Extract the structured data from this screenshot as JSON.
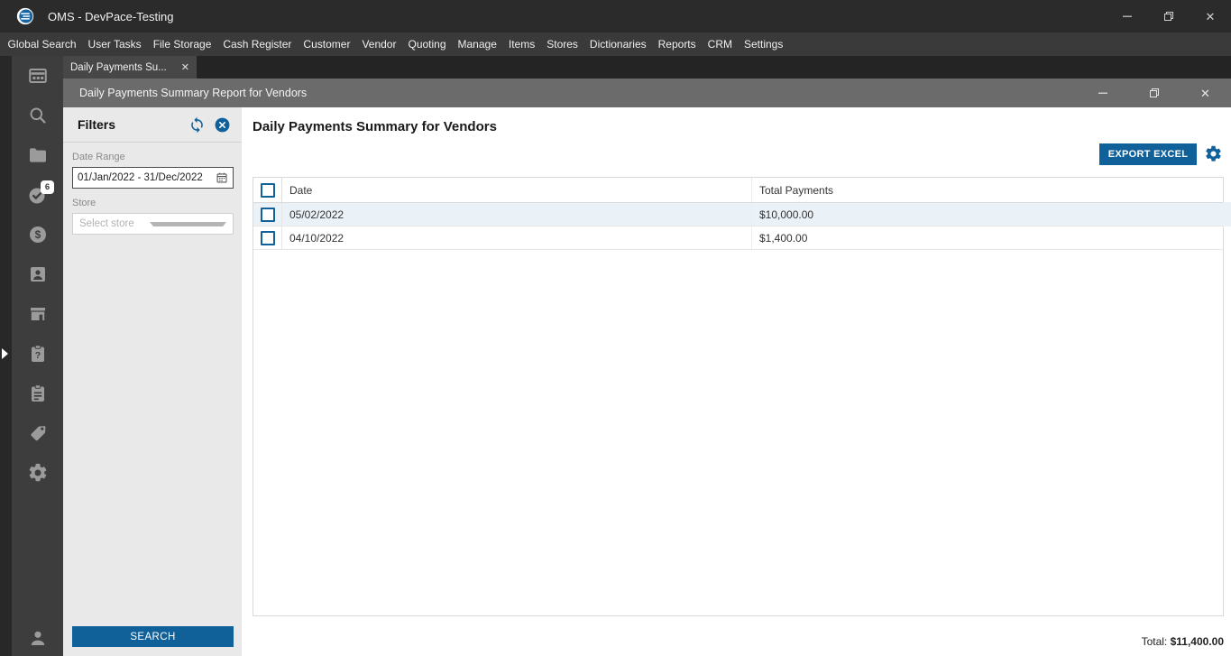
{
  "colors": {
    "accent": "#10609a",
    "row_highlight": "#eaf2f7",
    "titlebar_bg": "#2b2b2b",
    "menubar_bg": "#3a3a3a",
    "sidebar_bg": "#3d3d3d",
    "doc_titlebar_bg": "#6b6b6b",
    "filters_bg": "#e9e9e9"
  },
  "titlebar": {
    "title": "OMS - DevPace-Testing",
    "controls": {
      "minimize": "minimize",
      "restore": "restore",
      "close": "✕"
    }
  },
  "menubar": {
    "items": [
      "Global Search",
      "User Tasks",
      "File Storage",
      "Cash Register",
      "Customer",
      "Vendor",
      "Quoting",
      "Manage",
      "Items",
      "Stores",
      "Dictionaries",
      "Reports",
      "CRM",
      "Settings"
    ]
  },
  "tabs": [
    {
      "label": "Daily Payments Su...",
      "close": "✕",
      "active": true
    }
  ],
  "doc_window": {
    "title": "Daily Payments Summary Report for Vendors"
  },
  "sidebar": {
    "icons": [
      {
        "name": "dashboard-icon"
      },
      {
        "name": "search-icon"
      },
      {
        "name": "folder-icon"
      },
      {
        "name": "tasks-check-icon",
        "badge": "6"
      },
      {
        "name": "dollar-icon"
      },
      {
        "name": "contact-card-icon"
      },
      {
        "name": "store-icon"
      },
      {
        "name": "clipboard-question-icon"
      },
      {
        "name": "clipboard-list-icon"
      },
      {
        "name": "tag-icon"
      },
      {
        "name": "gear-icon"
      }
    ],
    "bottom_icon": {
      "name": "user-icon"
    },
    "expand_arrow": "▶"
  },
  "filters": {
    "title": "Filters",
    "refresh_icon": "refresh-icon",
    "close_icon": "close-circle-icon",
    "date_range": {
      "label": "Date Range",
      "value": "01/Jan/2022 - 31/Dec/2022",
      "icon": "calendar-icon"
    },
    "store": {
      "label": "Store",
      "placeholder": "Select store"
    },
    "search_button": "SEARCH"
  },
  "report": {
    "title": "Daily Payments Summary for Vendors",
    "export_button": "EXPORT EXCEL",
    "settings_icon": "gear-icon"
  },
  "chart_data": {
    "type": "table",
    "columns": [
      "Date",
      "Total Payments"
    ],
    "rows": [
      {
        "date": "05/02/2022",
        "total": "$10,000.00",
        "highlighted": true
      },
      {
        "date": "04/10/2022",
        "total": "$1,400.00",
        "highlighted": false
      }
    ],
    "footer": {
      "total_label": "Total:",
      "total_value": "$11,400.00"
    }
  }
}
